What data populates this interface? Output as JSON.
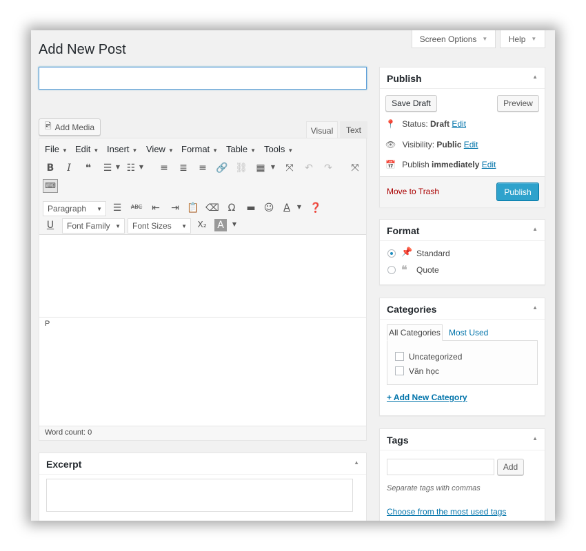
{
  "header": {
    "screen_options": "Screen Options",
    "help": "Help",
    "page_title": "Add New Post"
  },
  "editor": {
    "title_value": "",
    "add_media": "Add Media",
    "tab_visual": "Visual",
    "tab_text": "Text",
    "menu": [
      "File",
      "Edit",
      "Insert",
      "View",
      "Format",
      "Table",
      "Tools"
    ],
    "paragraph_select": "Paragraph",
    "font_family_select": "Font Family",
    "font_sizes_select": "Font Sizes",
    "path": "P",
    "word_count": "Word count: 0"
  },
  "excerpt": {
    "title": "Excerpt",
    "value": ""
  },
  "publish": {
    "title": "Publish",
    "save_draft": "Save Draft",
    "preview": "Preview",
    "status_label": "Status:",
    "status_value": "Draft",
    "visibility_label": "Visibility:",
    "visibility_value": "Public",
    "publish_label": "Publish",
    "publish_value": "immediately",
    "edit": "Edit",
    "move_to_trash": "Move to Trash",
    "publish_button": "Publish"
  },
  "format": {
    "title": "Format",
    "options": [
      {
        "label": "Standard",
        "selected": true
      },
      {
        "label": "Quote",
        "selected": false
      }
    ]
  },
  "categories": {
    "title": "Categories",
    "tab_all": "All Categories",
    "tab_most_used": "Most Used",
    "items": [
      {
        "label": "Uncategorized",
        "checked": false
      },
      {
        "label": "Văn học",
        "checked": false
      }
    ],
    "add_new": "+ Add New Category"
  },
  "tags": {
    "title": "Tags",
    "input_value": "",
    "add_button": "Add",
    "hint": "Separate tags with commas",
    "choose_link": "Choose from the most used tags"
  },
  "colors": {
    "accent": "#0073aa",
    "primary_button": "#2ea2cc",
    "trash": "#a00000",
    "background": "#f1f1f1"
  }
}
